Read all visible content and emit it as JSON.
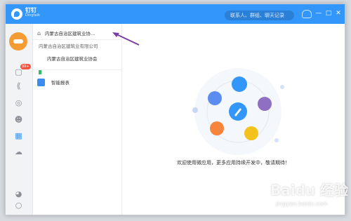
{
  "app": {
    "brand_cn": "钉钉",
    "brand_en": "Dingtalk"
  },
  "search": {
    "placeholder": "联系人、群组、聊天记录"
  },
  "window_controls": {
    "minimize": "—",
    "maximize": "□",
    "close": "✕"
  },
  "sidebar": {
    "badge": "99+"
  },
  "org": {
    "name": "内蒙古自治区建筑业协..."
  },
  "org_menu": {
    "items": [
      {
        "label": "内蒙古自治区建筑业有限公司"
      },
      {
        "label": "内蒙古自治区建筑业协会"
      }
    ]
  },
  "apps": [
    {
      "label": "智能报表"
    }
  ],
  "main": {
    "empty_message": "欢迎使用微应用，更多应用持续开发中，敬请期待！"
  },
  "watermark": {
    "main": "Baidu 经验",
    "sub": "jingyan.baidu.com"
  },
  "colors": {
    "brand": "#3296fa",
    "accent_arrow": "#7b3fa3"
  }
}
